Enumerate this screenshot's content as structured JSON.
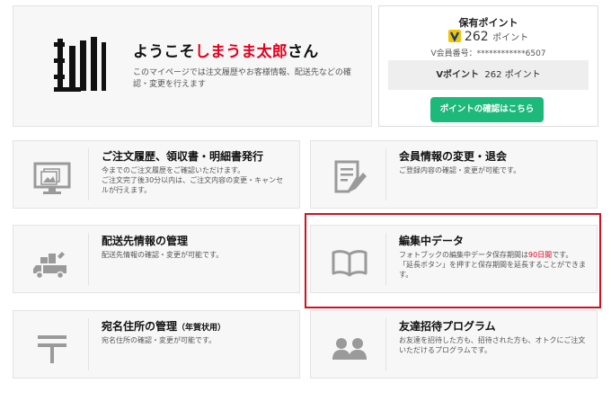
{
  "welcome": {
    "greeting_prefix": "ようこそ",
    "user_name": "しまうま太郎",
    "greeting_suffix": "さん",
    "description": "このマイページでは注文履歴やお客様情報、配送先などの確認・変更を行えます"
  },
  "points": {
    "title": "保有ポイント",
    "value": "262",
    "unit": "ポイント",
    "member_number": "V会員番号：************6507",
    "vpoint_label": "Vポイント",
    "vpoint_value": "262 ポイント",
    "button_label": "ポイントの確認はこちら",
    "button_color": "#1db97a"
  },
  "cards": {
    "orders": {
      "icon": "monitor-image-icon",
      "title": "ご注文履歴、領収書・明細書発行",
      "text1": "今までのご注文履歴をご確認いただけます。",
      "text2": "ご注文完了後30分以内は、ご注文内容の変更・キャンセルが行えます。"
    },
    "member": {
      "icon": "edit-document-icon",
      "title": "会員情報の変更・退会",
      "text1": "ご登録内容の確認・変更が可能です。"
    },
    "shipping": {
      "icon": "delivery-truck-icon",
      "title": "配送先情報の管理",
      "text1": "配送先情報の確認・変更が可能です。"
    },
    "editing": {
      "icon": "open-book-icon",
      "title": "編集中データ",
      "text1_before": "フォトブックの編集中データ保存期間は",
      "text1_highlight": "90日間",
      "text1_after": "です。",
      "text2": "「延長ボタン」を押すと保存期間を延長することができます。"
    },
    "address": {
      "icon": "postal-mark-icon",
      "title": "宛名住所の管理",
      "title_small": "（年賀状用）",
      "text1": "宛名住所の確認・変更が可能です。"
    },
    "invite": {
      "icon": "friends-icon",
      "title": "友達招待プログラム",
      "text1": "お友達を招待した方も、招待された方も、オトクにご注文いただけるプログラムです。"
    }
  },
  "colors": {
    "accent_red": "#e4001e",
    "highlight_border": "#d50f1e",
    "icon_gray": "#9a9a9a"
  }
}
